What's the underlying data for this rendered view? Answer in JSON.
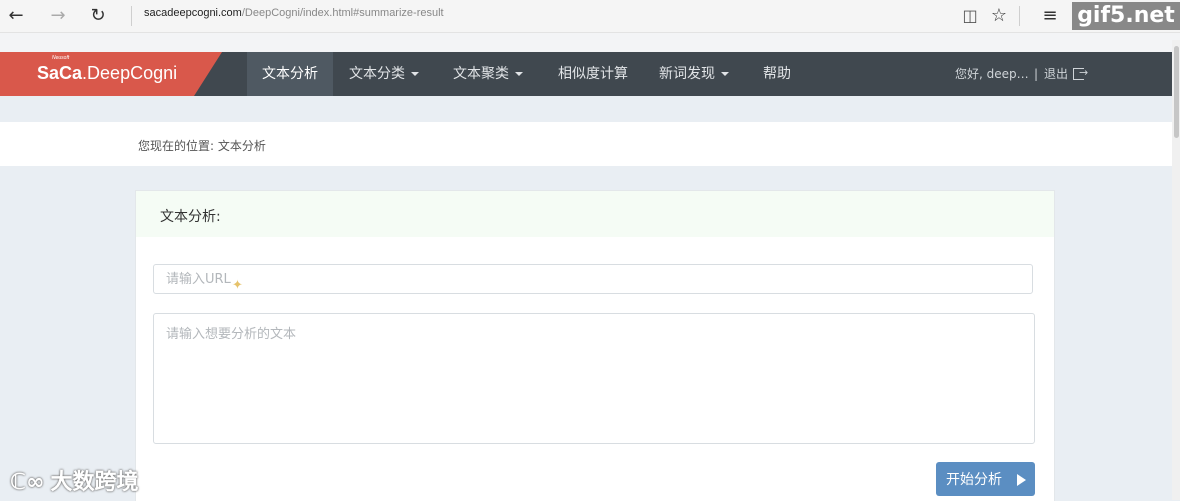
{
  "browser": {
    "url_domain": "sacadeepcogni.com",
    "url_path": "/DeepCogni/index.html#summarize-result",
    "watermark": "gif5.net"
  },
  "brand": {
    "small": "Neusoft",
    "name_prefix": "SaCa",
    "name_suffix": "DeepCogni"
  },
  "nav": {
    "items": [
      {
        "label": "文本分析",
        "dropdown": false,
        "active": true
      },
      {
        "label": "文本分类",
        "dropdown": true
      },
      {
        "label": "文本聚类",
        "dropdown": true
      },
      {
        "label": "相似度计算",
        "dropdown": false
      },
      {
        "label": "新词发现",
        "dropdown": true
      },
      {
        "label": "帮助",
        "dropdown": false
      }
    ],
    "greeting": "您好, deep…",
    "separator": "|",
    "logout": "退出"
  },
  "breadcrumb": "您现在的位置: 文本分析",
  "panel": {
    "title": "文本分析:",
    "url_placeholder": "请输入URL",
    "text_placeholder": "请输入想要分析的文本",
    "start_button": "开始分析"
  },
  "watermark_bottom": "大数跨境"
}
